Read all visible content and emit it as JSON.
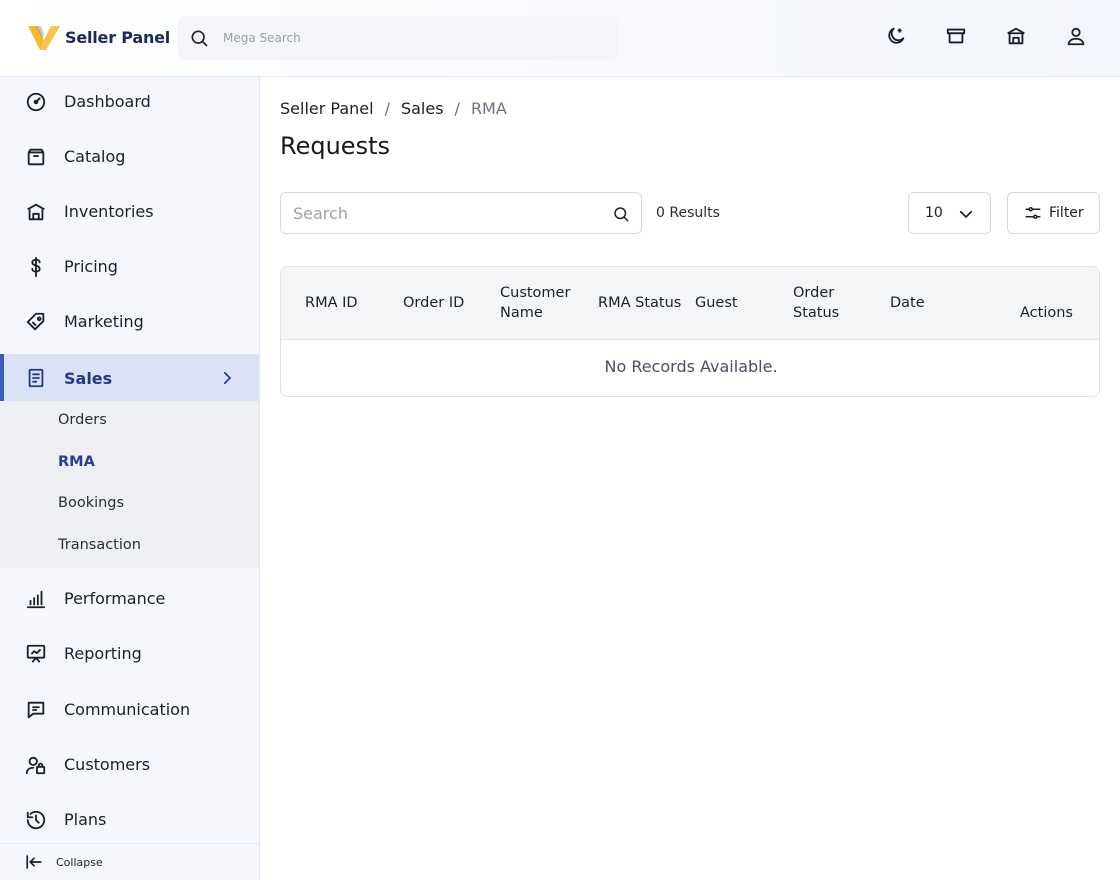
{
  "header": {
    "brand": "Seller Panel",
    "search_placeholder": "Mega Search",
    "icons": [
      "moon-icon",
      "store-icon",
      "building-icon",
      "user-icon"
    ]
  },
  "sidebar": {
    "items": [
      {
        "label": "Dashboard",
        "icon": "dashboard-icon"
      },
      {
        "label": "Catalog",
        "icon": "catalog-icon"
      },
      {
        "label": "Inventories",
        "icon": "inventories-icon"
      },
      {
        "label": "Pricing",
        "icon": "dollar-icon"
      },
      {
        "label": "Marketing",
        "icon": "tag-icon"
      },
      {
        "label": "Sales",
        "icon": "receipt-icon",
        "active": true
      },
      {
        "label": "Performance",
        "icon": "bar-chart-icon"
      },
      {
        "label": "Reporting",
        "icon": "presentation-icon"
      },
      {
        "label": "Communication",
        "icon": "chat-icon"
      },
      {
        "label": "Customers",
        "icon": "customers-icon"
      },
      {
        "label": "Plans",
        "icon": "history-icon"
      }
    ],
    "sales_subitems": [
      {
        "label": "Orders"
      },
      {
        "label": "RMA",
        "active": true
      },
      {
        "label": "Bookings"
      },
      {
        "label": "Transaction"
      }
    ],
    "collapse_label": "Collapse"
  },
  "main": {
    "breadcrumb": [
      "Seller Panel",
      "Sales",
      "RMA"
    ],
    "breadcrumb_separator": "/",
    "title": "Requests",
    "search_placeholder": "Search",
    "results_text": "0 Results",
    "per_page": "10",
    "filter_label": "Filter",
    "table": {
      "columns": [
        {
          "line1": "RMA ID",
          "line2": ""
        },
        {
          "line1": "Order ID",
          "line2": ""
        },
        {
          "line1": "Customer",
          "line2": "Name"
        },
        {
          "line1": "RMA Status",
          "line2": ""
        },
        {
          "line1": "Guest",
          "line2": ""
        },
        {
          "line1": "Order",
          "line2": "Status"
        },
        {
          "line1": "Date",
          "line2": ""
        },
        {
          "line1": "Actions",
          "line2": ""
        }
      ],
      "empty_text": "No Records Available."
    }
  },
  "colors": {
    "accent": "#3a5bbd",
    "active_bg": "#dbe2f5",
    "sidebar_bg": "#f5f7fd",
    "logo_yellow": "#f5b82e",
    "logo_navy": "#1e2a55"
  }
}
